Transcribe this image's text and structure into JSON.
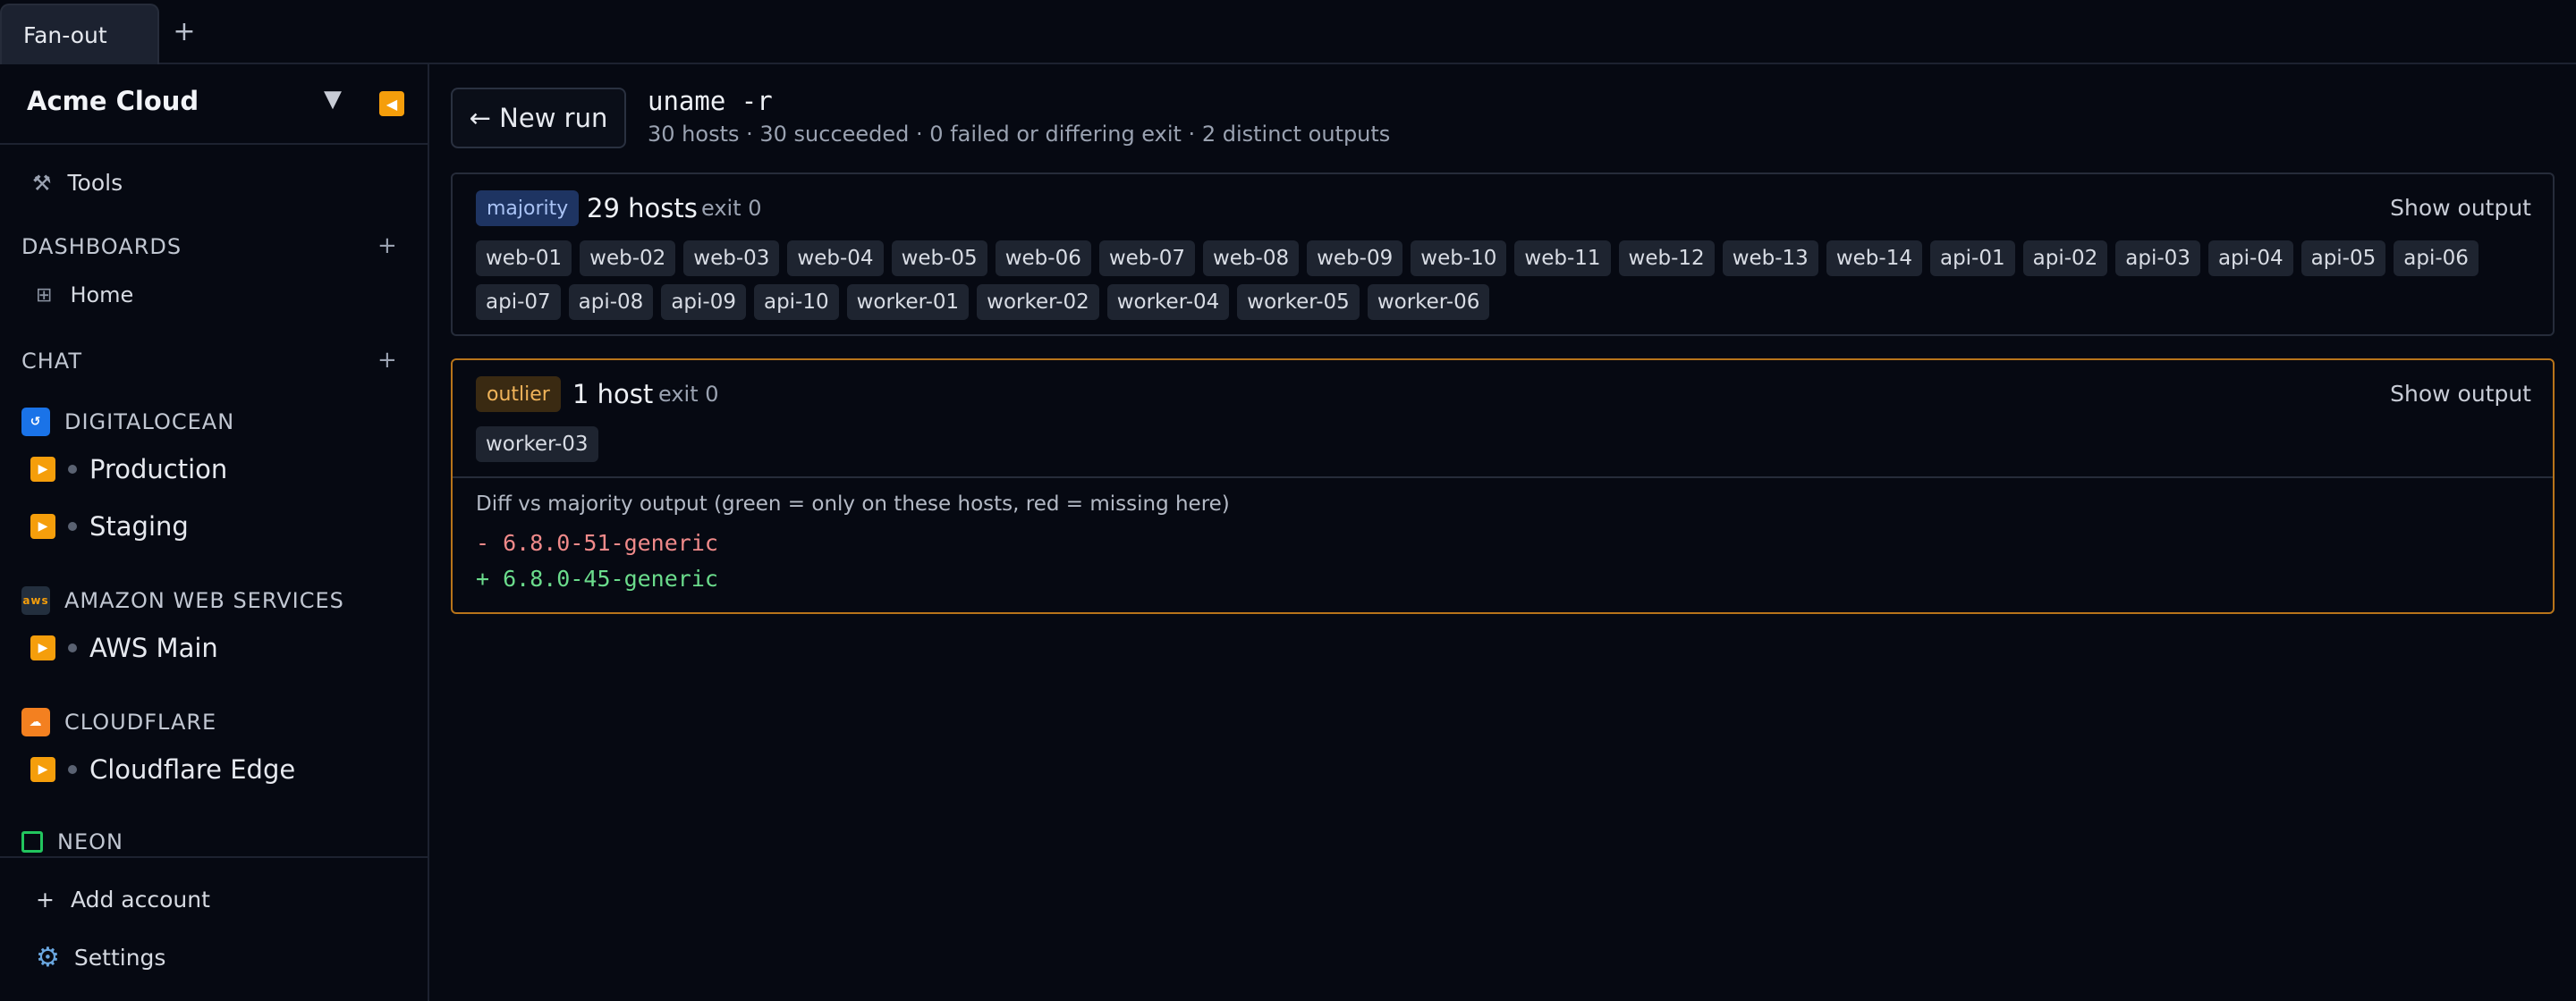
{
  "tabs": [
    {
      "label": "Fan-out"
    }
  ],
  "tab_add": "+",
  "sidebar": {
    "org": "Acme Cloud",
    "tools": "Tools",
    "dashboards": {
      "title": "DASHBOARDS",
      "add": "+",
      "items": [
        "Home"
      ]
    },
    "chat": {
      "title": "CHAT",
      "add": "+"
    },
    "providers": [
      {
        "name": "DIGITALOCEAN",
        "accounts": [
          "Production",
          "Staging"
        ]
      },
      {
        "name": "AMAZON WEB SERVICES",
        "logo": "aws",
        "accounts": [
          "AWS Main"
        ]
      },
      {
        "name": "CLOUDFLARE",
        "accounts": [
          "Cloudflare Edge"
        ]
      },
      {
        "name": "NEON",
        "accounts": []
      }
    ],
    "add_account": "Add account",
    "settings": "Settings"
  },
  "main": {
    "new_run": "← New run",
    "command": "uname -r",
    "summary": "30 hosts · 30 succeeded · 0 failed or differing exit · 2 distinct outputs",
    "groups": [
      {
        "badge": "majority",
        "count": "29 hosts",
        "exit": "exit 0",
        "show_output": "Show output",
        "hosts": [
          "web-01",
          "web-02",
          "web-03",
          "web-04",
          "web-05",
          "web-06",
          "web-07",
          "web-08",
          "web-09",
          "web-10",
          "web-11",
          "web-12",
          "web-13",
          "web-14",
          "api-01",
          "api-02",
          "api-03",
          "api-04",
          "api-05",
          "api-06",
          "api-07",
          "api-08",
          "api-09",
          "api-10",
          "worker-01",
          "worker-02",
          "worker-04",
          "worker-05",
          "worker-06"
        ]
      },
      {
        "badge": "outlier",
        "count": "1 host",
        "exit": "exit 0",
        "show_output": "Show output",
        "hosts": [
          "worker-03"
        ],
        "diff_note": "Diff vs majority output (green = only on these hosts, red = missing here)",
        "diff_minus": "- 6.8.0-51-generic",
        "diff_plus": "+ 6.8.0-45-generic"
      }
    ]
  },
  "colors": {
    "accent": "#f59e0b",
    "majority": "#1e3462",
    "outlier_border": "#b8741a",
    "diff_add": "#6bdc8c",
    "diff_remove": "#f08a8a"
  }
}
